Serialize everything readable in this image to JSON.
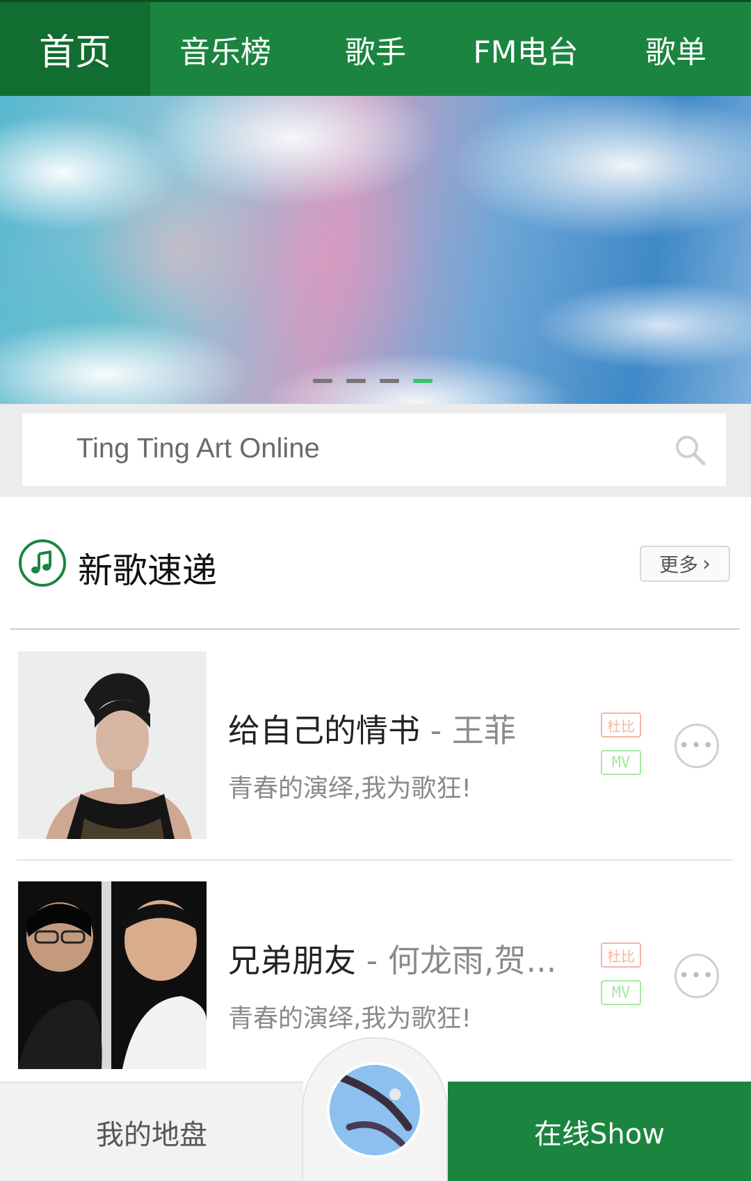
{
  "topnav": {
    "tabs": [
      {
        "label": "首页",
        "active": true
      },
      {
        "label": "音乐榜",
        "active": false
      },
      {
        "label": "歌手",
        "active": false
      },
      {
        "label": "FM电台",
        "active": false
      },
      {
        "label": "歌单",
        "active": false
      }
    ]
  },
  "banner": {
    "slide_count": 4,
    "active_slide": 4
  },
  "search": {
    "placeholder": "Ting Ting Art Online",
    "icon": "search-icon"
  },
  "section": {
    "icon": "music-note-icon",
    "title": "新歌速递",
    "more_label": "更多"
  },
  "songs": [
    {
      "title": "给自己的情书",
      "separator": " - ",
      "artist": "王菲",
      "description": "青春的演绎,我为歌狂!",
      "tag_dolby": "杜比",
      "tag_mv": "MV"
    },
    {
      "title": "兄弟朋友",
      "separator": " - ",
      "artist": "何龙雨,贺...",
      "description": "青春的演绎,我为歌狂!",
      "tag_dolby": "杜比",
      "tag_mv": "MV"
    }
  ],
  "bottombar": {
    "left_label": "我的地盘",
    "right_label": "在线Show"
  },
  "colors": {
    "brand_green": "#1b8540",
    "active_tab": "#126d30",
    "dot_active": "#3cc26a",
    "dolby_tag": "#f2b79f",
    "mv_tag": "#a6e89e"
  }
}
